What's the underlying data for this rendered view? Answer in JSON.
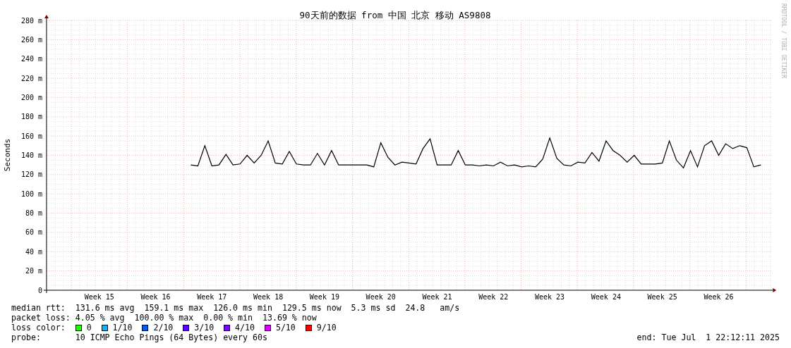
{
  "chart": {
    "credit": "RRDTOOL / TOBI OETIKER",
    "chart_data": {
      "type": "line",
      "grid": true,
      "title": "90天前的数据 from 中国 北京 移动 AS9808",
      "ylabel": "Seconds",
      "ylim": [
        0,
        280
      ],
      "categories": [
        null,
        null,
        null,
        null,
        null,
        null,
        null,
        "Week 15",
        null,
        null,
        null,
        null,
        null,
        null,
        null,
        "Week 16",
        null,
        null,
        null,
        null,
        null,
        null,
        null,
        "Week 17",
        null,
        null,
        null,
        null,
        null,
        null,
        null,
        "Week 18",
        null,
        null,
        null,
        null,
        null,
        null,
        null,
        "Week 19",
        null,
        null,
        null,
        null,
        null,
        null,
        null,
        "Week 20",
        null,
        null,
        null,
        null,
        null,
        null,
        null,
        "Week 21",
        null,
        null,
        null,
        null,
        null,
        null,
        null,
        "Week 22",
        null,
        null,
        null,
        null,
        null,
        null,
        null,
        "Week 23",
        null,
        null,
        null,
        null,
        null,
        null,
        null,
        "Week 24",
        null,
        null,
        null,
        null,
        null,
        null,
        null,
        "Week 25",
        null,
        null,
        null,
        null,
        null,
        null,
        null,
        "Week 26",
        null,
        null,
        null,
        null,
        null,
        null,
        null
      ],
      "yticks": [
        {
          "value": 0,
          "label": "0"
        },
        {
          "value": 20,
          "label": "20 m"
        },
        {
          "value": 40,
          "label": "40 m"
        },
        {
          "value": 60,
          "label": "60 m"
        },
        {
          "value": 80,
          "label": "80 m"
        },
        {
          "value": 100,
          "label": "100 m"
        },
        {
          "value": 120,
          "label": "120 m"
        },
        {
          "value": 140,
          "label": "140 m"
        },
        {
          "value": 160,
          "label": "160 m"
        },
        {
          "value": 180,
          "label": "180 m"
        },
        {
          "value": 200,
          "label": "200 m"
        },
        {
          "value": 220,
          "label": "220 m"
        },
        {
          "value": 240,
          "label": "240 m"
        },
        {
          "value": 260,
          "label": "260 m"
        },
        {
          "value": 280,
          "label": "280 m"
        }
      ],
      "series": [
        {
          "color": "#000000",
          "values": [
            null,
            null,
            null,
            null,
            null,
            null,
            null,
            null,
            null,
            null,
            null,
            null,
            null,
            null,
            null,
            null,
            null,
            null,
            null,
            null,
            130,
            129,
            150,
            129,
            130,
            141,
            130,
            131,
            140,
            132,
            140,
            155,
            132,
            131,
            144,
            131,
            130,
            130,
            142,
            130,
            145,
            130,
            130,
            130,
            130,
            130,
            128,
            153,
            138,
            130,
            133,
            132,
            131,
            147,
            157,
            130,
            130,
            130,
            145,
            130,
            130,
            129,
            130,
            129,
            133,
            129,
            130,
            128,
            129,
            128,
            136,
            158,
            137,
            130,
            129,
            133,
            132,
            143,
            134,
            155,
            145,
            140,
            133,
            140,
            131,
            131,
            131,
            132,
            155,
            135,
            127,
            145,
            128,
            150,
            155,
            140,
            152,
            147,
            150,
            148,
            128,
            130,
            null
          ]
        }
      ]
    }
  },
  "stats": [
    {
      "label": "median rtt:",
      "value": "131.6 ms avg  159.1 ms max  126.0 ms min  129.5 ms now  5.3 ms sd  24.8   am/s"
    },
    {
      "label": "packet loss:",
      "value": "4.05 % avg  100.00 % max  0.00 % min  13.69 % now"
    }
  ],
  "loss_colors": {
    "label": "loss color:",
    "items": [
      {
        "label": "0",
        "color": "#26ff00"
      },
      {
        "label": "1/10",
        "color": "#00b8ff"
      },
      {
        "label": "2/10",
        "color": "#0059ff"
      },
      {
        "label": "3/10",
        "color": "#5e00ff"
      },
      {
        "label": "4/10",
        "color": "#7e00ff"
      },
      {
        "label": "5/10",
        "color": "#dd00ff"
      },
      {
        "label": "9/10",
        "color": "#ff0000"
      }
    ]
  },
  "probe": {
    "label": "probe:",
    "value": "10 ICMP Echo Pings (64 Bytes) every 60s"
  },
  "end": "end: Tue Jul  1 22:12:11 2025"
}
